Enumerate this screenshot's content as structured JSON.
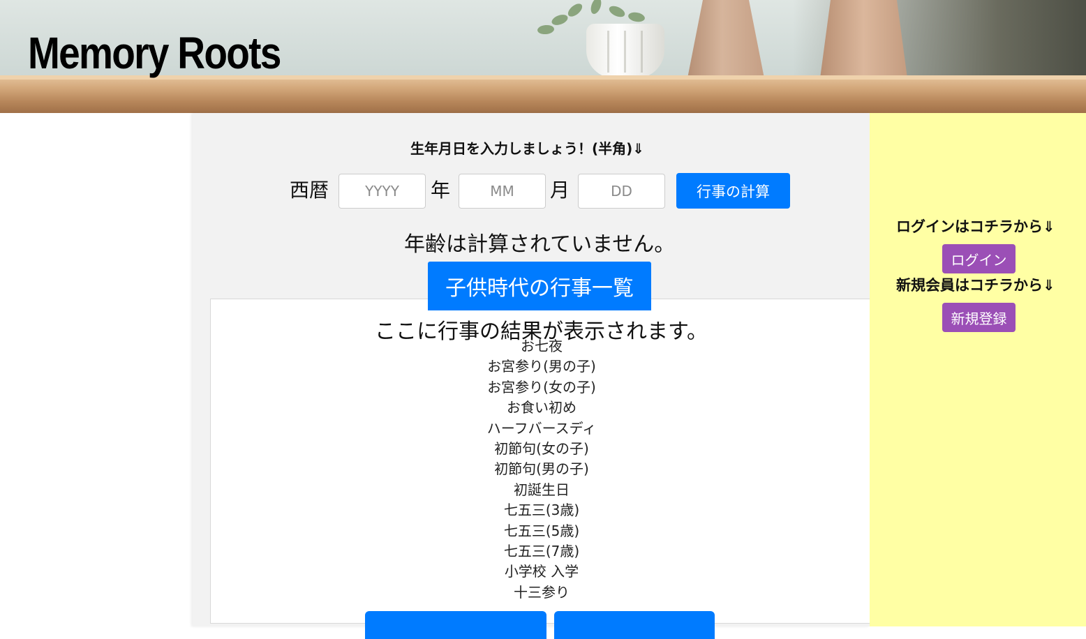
{
  "header": {
    "site_title": "Memory Roots"
  },
  "form": {
    "prompt": "生年月日を入力しましょう！(半角)⇓",
    "era_label": "西暦",
    "year_unit": "年",
    "month_unit": "月",
    "year_placeholder": "YYYY",
    "month_placeholder": "MM",
    "day_placeholder": "DD",
    "year_value": "",
    "month_value": "",
    "day_value": "",
    "calc_button": "行事の計算"
  },
  "age_status": "年齢は計算されていません。",
  "results": {
    "tab_button": "子供時代の行事一覧",
    "heading": "ここに行事の結果が表示されます。",
    "events": [
      "お七夜",
      "お宮参り(男の子)",
      "お宮参り(女の子)",
      "お食い初め",
      "ハーフバースディ",
      "初節句(女の子)",
      "初節句(男の子)",
      "初誕生日",
      "七五三(3歳)",
      "七五三(5歳)",
      "七五三(7歳)",
      "小学校 入学",
      "十三参り"
    ]
  },
  "sidebar": {
    "login_heading": "ログインはコチラから⇓",
    "login_button": "ログイン",
    "register_heading": "新規会員はコチラから⇓",
    "register_button": "新規登録"
  },
  "colors": {
    "primary_blue": "#007bff",
    "accent_purple": "#9b4fb6",
    "sidebar_yellow": "#ffffa4",
    "panel_gray": "#f2f2f2"
  }
}
